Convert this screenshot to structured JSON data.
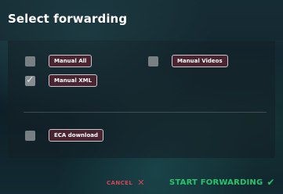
{
  "dialog": {
    "title": "Select forwarding"
  },
  "options": [
    {
      "label": "Manual All",
      "checked": false
    },
    {
      "label": "Manual Videos",
      "checked": false
    },
    {
      "label": "Manual XML",
      "checked": true
    },
    {
      "label": "ECA download",
      "checked": false
    }
  ],
  "footer": {
    "cancel_label": "CANCEL",
    "start_label": "START FORWARDING"
  },
  "colors": {
    "cancel": "#d4455a",
    "confirm": "#25c66a",
    "label_background": "#4a2430"
  },
  "icons": {
    "cancel": "close-icon",
    "confirm": "checkmark-icon"
  }
}
